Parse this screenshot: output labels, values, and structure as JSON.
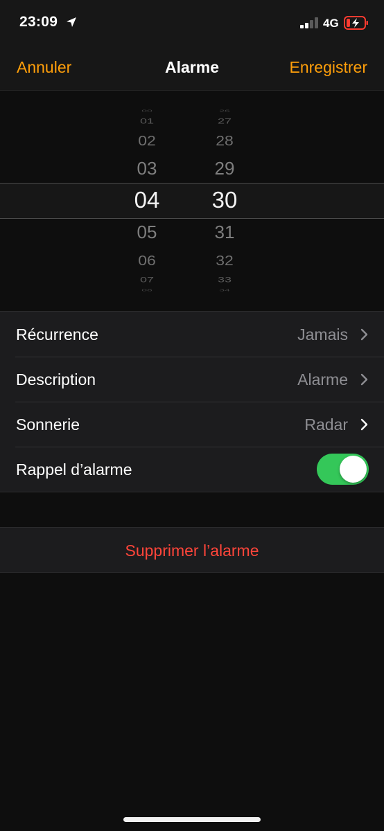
{
  "status_bar": {
    "time": "23:09",
    "network": "4G",
    "location_icon": "location-arrow-icon",
    "signal_icon": "cellular-signal-icon",
    "battery_icon": "battery-charging-icon",
    "battery_color": "#ff3b30"
  },
  "nav": {
    "cancel_label": "Annuler",
    "title": "Alarme",
    "save_label": "Enregistrer",
    "accent_color": "#ff9f0a"
  },
  "picker": {
    "hours": [
      "00",
      "01",
      "02",
      "03",
      "04",
      "05",
      "06",
      "07",
      "08"
    ],
    "selected_hour": "04",
    "minutes": [
      "26",
      "27",
      "28",
      "29",
      "30",
      "31",
      "32",
      "33",
      "34"
    ],
    "selected_minute": "30"
  },
  "settings": {
    "repeat": {
      "label": "Récurrence",
      "value": "Jamais"
    },
    "description": {
      "label": "Description",
      "value": "Alarme"
    },
    "sound": {
      "label": "Sonnerie",
      "value": "Radar"
    },
    "snooze": {
      "label": "Rappel d’alarme",
      "enabled": true,
      "on_color": "#34c759"
    }
  },
  "delete": {
    "label": "Supprimer l’alarme",
    "color": "#ff453a"
  }
}
